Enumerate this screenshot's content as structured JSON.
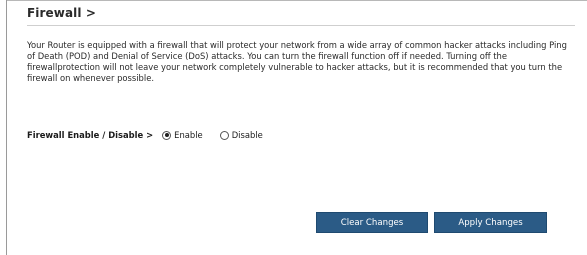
{
  "page": {
    "title": "Firewall >",
    "description": "Your Router is equipped with a firewall that will protect your network from a wide array of common hacker attacks including Ping of Death (POD) and Denial of Service (DoS) attacks. You can turn the firewall function off if needed. Turning off the firewallprotection will not leave your network completely vulnerable to hacker attacks, but it is recommended that you turn the firewall on whenever possible."
  },
  "firewall_setting": {
    "label": "Firewall Enable / Disable >",
    "options": [
      {
        "label": "Enable",
        "selected": true
      },
      {
        "label": "Disable",
        "selected": false
      }
    ]
  },
  "buttons": {
    "clear": "Clear Changes",
    "apply": "Apply Changes"
  },
  "colors": {
    "button_bg": "#2b5b86",
    "button_text": "#ffffff"
  }
}
